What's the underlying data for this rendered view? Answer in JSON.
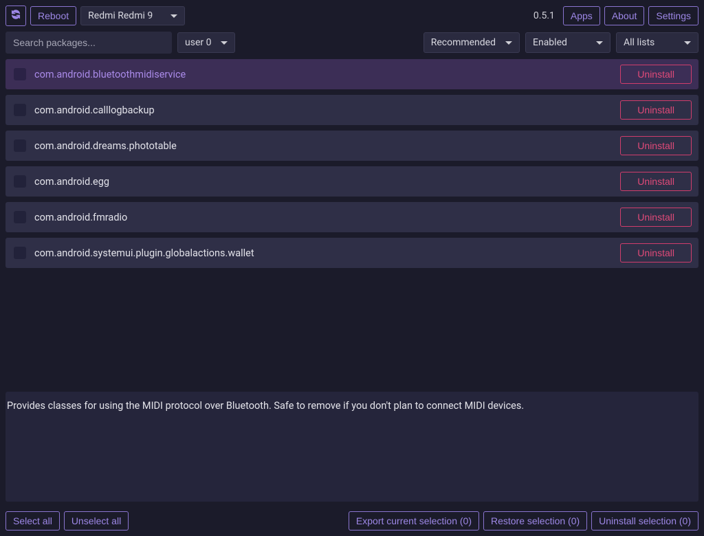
{
  "topbar": {
    "reboot_label": "Reboot",
    "device_name": "Redmi Redmi 9",
    "version": "0.5.1",
    "apps_label": "Apps",
    "about_label": "About",
    "settings_label": "Settings"
  },
  "filters": {
    "search_placeholder": "Search packages...",
    "user_label": "user 0",
    "category_label": "Recommended",
    "status_label": "Enabled",
    "list_label": "All lists"
  },
  "packages": [
    {
      "name": "com.android.bluetoothmidiservice",
      "action": "Uninstall",
      "selected": true
    },
    {
      "name": "com.android.calllogbackup",
      "action": "Uninstall",
      "selected": false
    },
    {
      "name": "com.android.dreams.phototable",
      "action": "Uninstall",
      "selected": false
    },
    {
      "name": "com.android.egg",
      "action": "Uninstall",
      "selected": false
    },
    {
      "name": "com.android.fmradio",
      "action": "Uninstall",
      "selected": false
    },
    {
      "name": "com.android.systemui.plugin.globalactions.wallet",
      "action": "Uninstall",
      "selected": false
    }
  ],
  "description": "Provides classes for using the MIDI protocol over Bluetooth. Safe to remove if you don't plan to connect MIDI devices.",
  "bottombar": {
    "select_all": "Select all",
    "unselect_all": "Unselect all",
    "export_selection": "Export current selection (0)",
    "restore_selection": "Restore selection (0)",
    "uninstall_selection": "Uninstall selection (0)"
  }
}
